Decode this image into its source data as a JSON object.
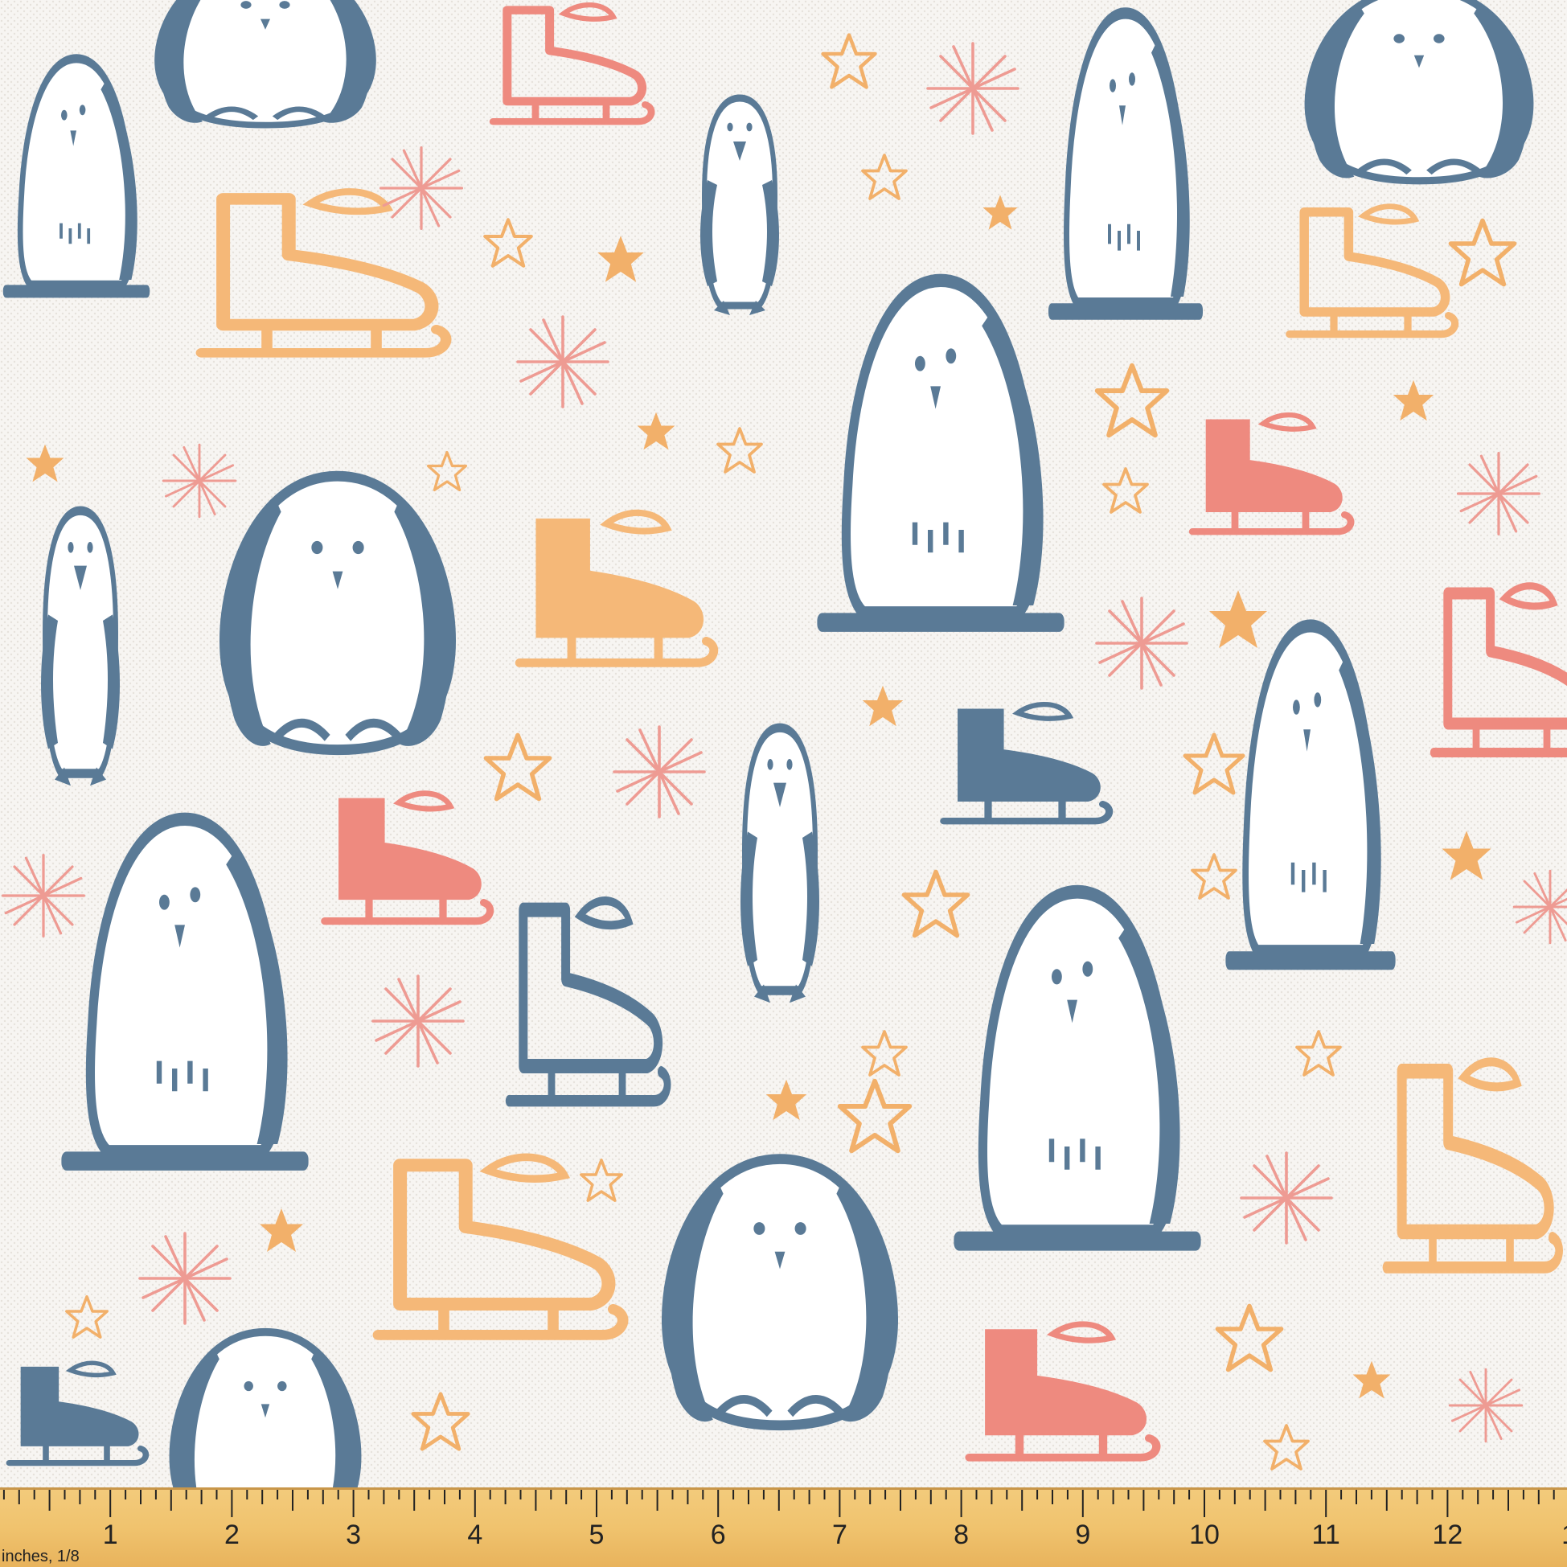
{
  "colors": {
    "fabric_background": "#f7f5f2",
    "penguin_blue": "#5a7a96",
    "skate_orange": "#f5b878",
    "skate_coral": "#ee8a7f",
    "star_orange": "#f2b06a",
    "snowflake_pink": "#ee9b93",
    "ruler_wood": "#f0c36e",
    "ruler_ink": "#222222"
  },
  "ruler": {
    "unit_label": "inches, 1/8",
    "numbers": [
      "1",
      "2",
      "3",
      "4",
      "5",
      "6",
      "7",
      "8",
      "9",
      "10",
      "11",
      "12",
      "1"
    ]
  }
}
